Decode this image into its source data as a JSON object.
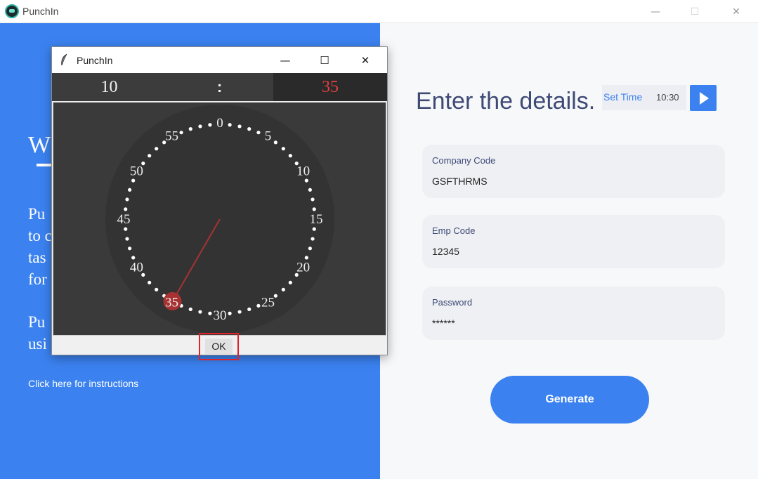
{
  "window": {
    "title": "PunchIn",
    "minimize": "—",
    "maximize": "☐",
    "close": "✕"
  },
  "left_panel": {
    "welcome_partial": "W",
    "description_partial": "Pu\nto c\ntas\nfor",
    "description2_partial": "Pu\nusi",
    "instructions_link": "Click here for instructions"
  },
  "right_panel": {
    "heading": "Enter the details.",
    "set_time_label": "Set Time",
    "set_time_value": "10:30",
    "fields": [
      {
        "label": "Company Code",
        "value": "GSFTHRMS"
      },
      {
        "label": "Emp Code",
        "value": "12345"
      },
      {
        "label": "Password",
        "value": "******"
      }
    ],
    "generate_label": "Generate"
  },
  "dialog": {
    "title": "PunchIn",
    "minimize": "—",
    "maximize": "☐",
    "close": "✕",
    "hours": "10",
    "separator": ":",
    "minutes": "35",
    "selected_minute": 35,
    "dial_labels": [
      "0",
      "5",
      "10",
      "15",
      "20",
      "25",
      "30",
      "35",
      "40",
      "45",
      "50",
      "55"
    ],
    "ok_label": "OK"
  },
  "colors": {
    "accent_blue": "#3b82f0",
    "heading_navy": "#3f4a75",
    "dial_bg": "#333333",
    "hand_red": "#a83232",
    "highlight_red": "#e0222a"
  }
}
